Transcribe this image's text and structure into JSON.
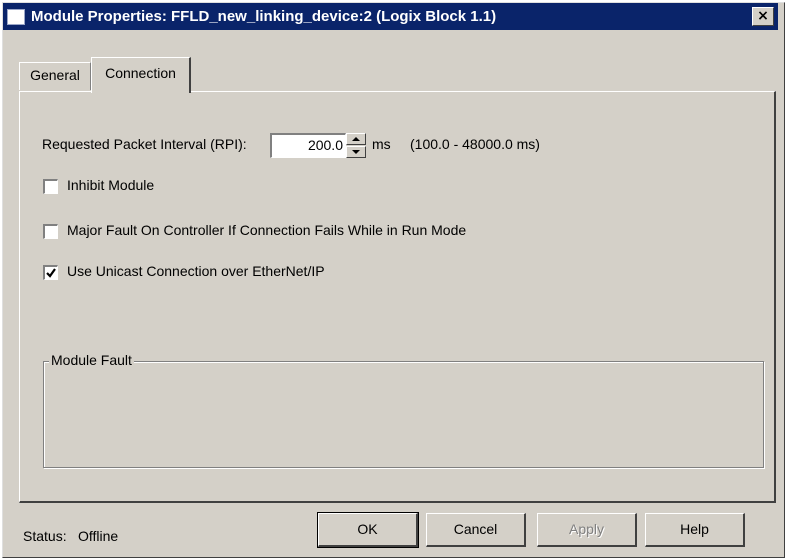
{
  "window": {
    "title": "Module Properties: FFLD_new_linking_device:2 (Logix Block 1.1)",
    "close_symbol": "×"
  },
  "tabs": [
    {
      "label": "General",
      "active": false
    },
    {
      "label": "Connection",
      "active": true
    }
  ],
  "connection": {
    "rpi_label": "Requested Packet Interval (RPI):",
    "rpi_value": "200.0",
    "rpi_unit": "ms",
    "rpi_range": "(100.0 - 48000.0 ms)",
    "inhibit_label": "Inhibit Module",
    "inhibit_checked": false,
    "major_fault_label": "Major Fault On Controller If Connection Fails While in Run Mode",
    "major_fault_checked": false,
    "unicast_label": "Use Unicast Connection over EtherNet/IP",
    "unicast_checked": true,
    "module_fault_label": "Module Fault"
  },
  "footer": {
    "status_label": "Status:",
    "status_value": "Offline",
    "ok_label": "OK",
    "cancel_label": "Cancel",
    "apply_label": "Apply",
    "help_label": "Help"
  },
  "icons": {
    "title": "module-window-icon",
    "close": "close-icon",
    "spin_up": "spin-up-arrow-icon",
    "spin_down": "spin-down-arrow-icon",
    "check": "checkmark-icon"
  },
  "colors": {
    "title_bar": "#0a246a",
    "dialog_face": "#d4d0c8"
  }
}
